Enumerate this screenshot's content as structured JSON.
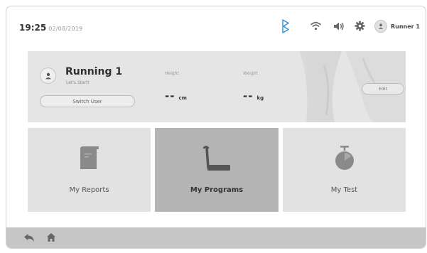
{
  "header": {
    "time": "19:25",
    "date": "02/08/2019",
    "user_name": "Runner 1"
  },
  "profile": {
    "name": "Running 1",
    "subtitle": "Let's Start!",
    "switch_label": "Switch User",
    "height_label": "Height",
    "height_value": "--",
    "height_unit": "cm",
    "weight_label": "Weight",
    "weight_value": "--",
    "weight_unit": "kg",
    "edit_label": "Edit"
  },
  "tiles": [
    {
      "label": "My Reports",
      "icon": "document-icon"
    },
    {
      "label": "My Programs",
      "icon": "treadmill-icon",
      "selected": true
    },
    {
      "label": "My Test",
      "icon": "stopwatch-icon"
    }
  ],
  "colors": {
    "tile": "#e2e2e2",
    "tile_selected": "#b4b4b4",
    "footer": "#c6c6c6",
    "bluetooth": "#2f8fd6"
  }
}
